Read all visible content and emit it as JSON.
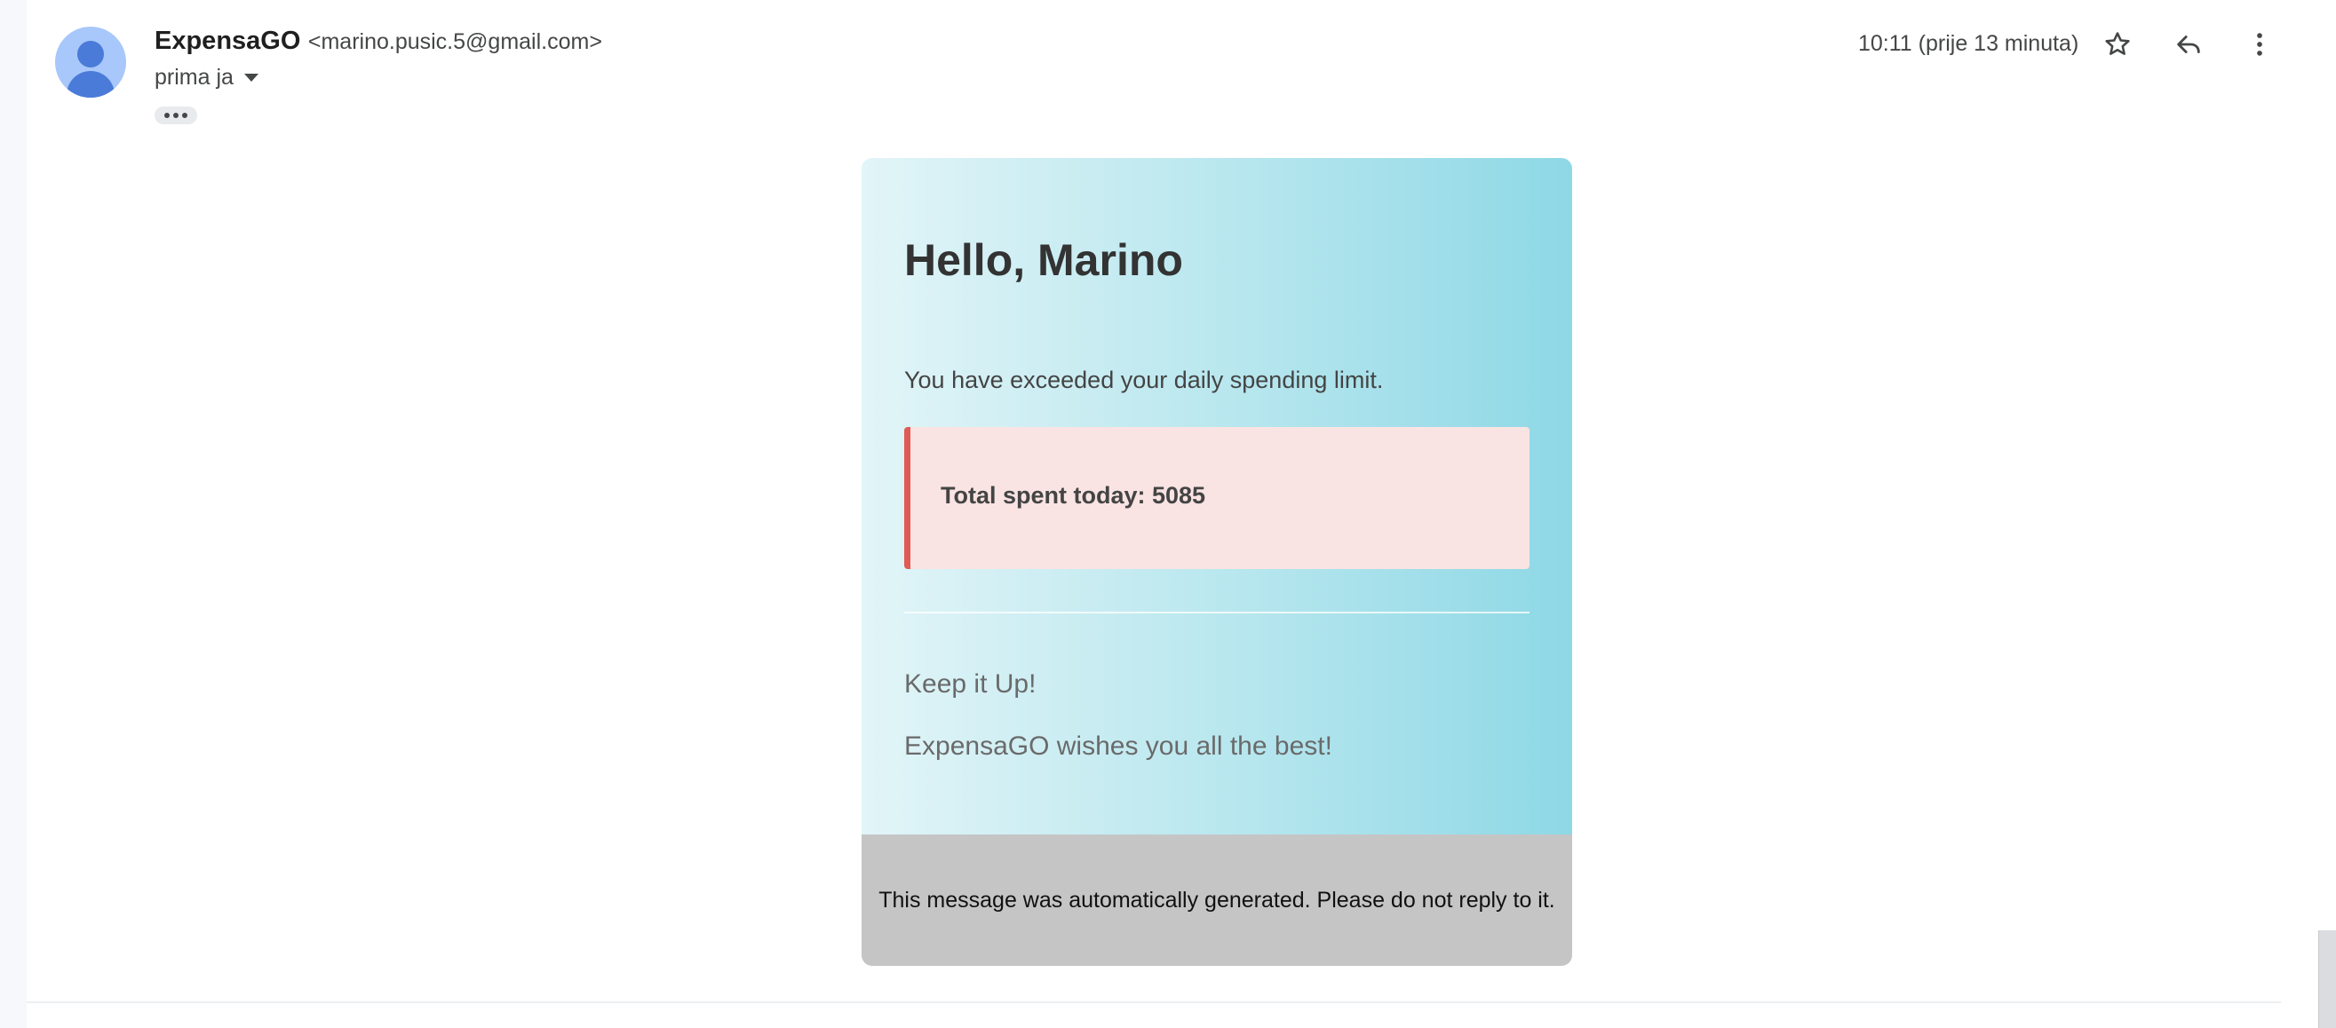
{
  "header": {
    "sender_name": "ExpensaGO",
    "sender_email": "<marino.pusic.5@gmail.com>",
    "recipient": "prima ja",
    "timestamp": "10:11 (prije 13 minuta)"
  },
  "icons": {
    "avatar": "person-avatar-icon",
    "star": "star-icon",
    "reply": "reply-icon",
    "more": "more-vert-icon",
    "show_trimmed": "more-horiz-icon",
    "recipient_caret": "caret-down-icon"
  },
  "email": {
    "greeting": "Hello, Marino",
    "message": "You have exceeded your daily spending limit.",
    "alert": "Total spent today: 5085",
    "keep_up": "Keep it Up!",
    "wishes": "ExpensaGO wishes you all the best!",
    "footer": "This message was automatically generated. Please do not reply to it."
  },
  "colors": {
    "alert_border": "#e05b55",
    "alert_background": "#f9e4e3",
    "gradient_start": "#e2f5f8",
    "gradient_end": "#8ed8e6",
    "footer_background": "#c6c5c6"
  }
}
